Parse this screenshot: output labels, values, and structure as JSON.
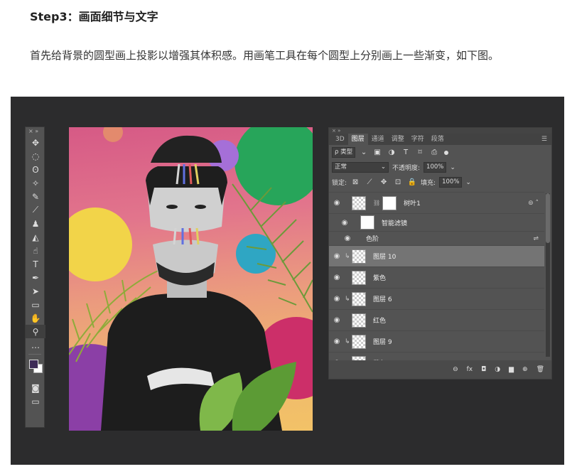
{
  "article": {
    "heading": "Step3：画面细节与文字",
    "paragraph": "首先给背景的圆型画上投影以增强其体积感。用画笔工具在每个圆型上分别画上一些渐变，如下图。"
  },
  "toolbar": {
    "collapse_marks": "×  »",
    "tools": [
      {
        "name": "move-tool",
        "glyph": "✥"
      },
      {
        "name": "marquee-tool",
        "glyph": "◌"
      },
      {
        "name": "lasso-tool",
        "glyph": "ʘ"
      },
      {
        "name": "magic-wand-tool",
        "glyph": "✧"
      },
      {
        "name": "eyedropper-tool",
        "glyph": "✎"
      },
      {
        "name": "brush-tool",
        "glyph": "⟋"
      },
      {
        "name": "stamp-tool",
        "glyph": "♟"
      },
      {
        "name": "eraser-tool",
        "glyph": "◭"
      },
      {
        "name": "smudge-tool",
        "glyph": "☝"
      },
      {
        "name": "type-tool",
        "glyph": "T"
      },
      {
        "name": "pen-tool",
        "glyph": "✒"
      },
      {
        "name": "path-select-tool",
        "glyph": "➤"
      },
      {
        "name": "rectangle-tool",
        "glyph": "▭"
      },
      {
        "name": "hand-tool",
        "glyph": "✋"
      },
      {
        "name": "zoom-tool",
        "glyph": "⚲"
      },
      {
        "name": "more-tools",
        "glyph": "…"
      }
    ],
    "bottom_tools": [
      {
        "name": "quick-mask-tool",
        "glyph": "◙"
      },
      {
        "name": "screen-mode-tool",
        "glyph": "▭"
      }
    ],
    "foreground_color": "#3d2b56",
    "background_color": "#ffffff"
  },
  "layers_panel": {
    "top_strip": "×  »",
    "tabs": [
      "3D",
      "图层",
      "通道",
      "调整",
      "字符",
      "段落"
    ],
    "active_tab": "图层",
    "menu_icon": "☰",
    "filter_kind": "ρ 类型",
    "filter_icons": [
      "▣",
      "◑",
      "T",
      "⌑",
      "⎙"
    ],
    "blend_mode": "正常",
    "opacity_label": "不透明度:",
    "opacity_value": "100%",
    "lock_label": "锁定:",
    "lock_icons": [
      "⊠",
      "⟋",
      "✥",
      "⊡",
      "🔒"
    ],
    "fill_label": "填充:",
    "fill_value": "100%",
    "layers": [
      {
        "name": "树叶1",
        "type": "smart",
        "right_icon": "⊚ ˄"
      },
      {
        "name": "智能滤镜",
        "type": "filter-mask"
      },
      {
        "name": "色阶",
        "type": "filter-item",
        "right_icon": "⇌"
      },
      {
        "name": "图层 10",
        "type": "clipped",
        "selected": true
      },
      {
        "name": "紫色",
        "type": "layer"
      },
      {
        "name": "图层 6",
        "type": "clipped"
      },
      {
        "name": "红色",
        "type": "layer"
      },
      {
        "name": "图层 9",
        "type": "clipped"
      },
      {
        "name": "蓝色",
        "type": "layer"
      }
    ],
    "bottom_icons": [
      "⊖",
      "fx",
      "◘",
      "◑",
      "▆",
      "⊕",
      "🗑"
    ]
  }
}
